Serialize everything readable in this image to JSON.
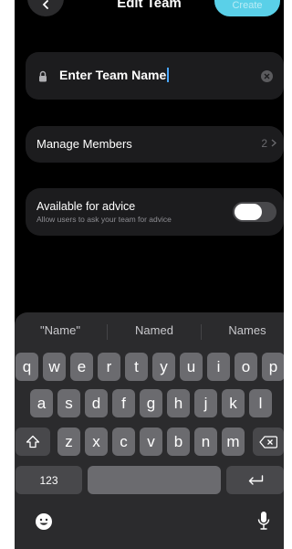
{
  "header": {
    "title": "Edit Team",
    "create_label": "Create"
  },
  "team_field": {
    "value": "Enter Team Name"
  },
  "manage_members": {
    "label": "Manage Members",
    "count": "2"
  },
  "advice": {
    "title": "Available for advice",
    "subtitle": "Allow users to ask your team for advice",
    "enabled": false
  },
  "keyboard": {
    "suggestions": [
      "\"Name\"",
      "Named",
      "Names"
    ],
    "row1": [
      "q",
      "w",
      "e",
      "r",
      "t",
      "y",
      "u",
      "i",
      "o",
      "p"
    ],
    "row2": [
      "a",
      "s",
      "d",
      "f",
      "g",
      "h",
      "j",
      "k",
      "l"
    ],
    "row3": [
      "z",
      "x",
      "c",
      "v",
      "b",
      "n",
      "m"
    ],
    "numbers_key": "123"
  },
  "colors": {
    "accent": "#5ad0e8",
    "cursor": "#4aa8ff",
    "card": "#1c1c1e"
  },
  "icons": [
    "back-icon",
    "lock-icon",
    "clear-icon",
    "chevron-right-icon",
    "shift-icon",
    "backspace-icon",
    "return-icon",
    "emoji-icon",
    "microphone-icon"
  ]
}
